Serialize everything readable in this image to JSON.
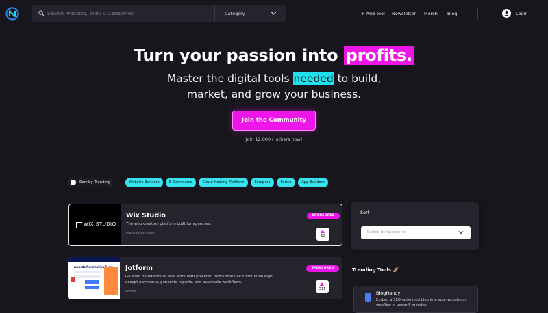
{
  "header": {
    "search_placeholder": "Search Products, Tools & Categories",
    "category_label": "Category",
    "nav": [
      "+ Add Tool",
      "Newsletter",
      "Merch",
      "Blog"
    ],
    "login_label": "Login"
  },
  "hero": {
    "title_part1": "Turn your passion into ",
    "title_highlight": "profits.",
    "subtitle_part1": "Master the digital tools ",
    "subtitle_highlight": "needed",
    "subtitle_part2": " to build,",
    "subtitle_line2": "market, and grow your business.",
    "cta_label": "Join the Community",
    "join_note": "Join 12,000+ others now!"
  },
  "filters": {
    "sort_label": "Sort by Trending",
    "chips": [
      "Website Builders",
      "E-Commerce",
      "Cloud Hosting Platform",
      "Scrapers",
      "Forms",
      "App Builders"
    ]
  },
  "tools": [
    {
      "name": "Wix Studio",
      "logo_text": "WIX STUDIO",
      "description": "The web creation platform built for agencies.",
      "category": "Website Builders",
      "badge": "SPONSORED",
      "votes": "62"
    },
    {
      "name": "Jotform",
      "thumb_caption": "Awards Nomination Form",
      "description": "Go from paperwork to less work with powerful forms that use conditional logic, accept payments, generate reports, and automate workflows.",
      "category": "Forms",
      "badge": "SPONSORED",
      "votes": "511"
    }
  ],
  "sidebar": {
    "sort_title": "Sort",
    "sort_value": "Sorted by Sponsored",
    "trending_title": "Trending Tools 🚀",
    "trending": [
      {
        "name": "BlogHandy",
        "description": "Embed a SEO optimized blog into your website or webflow in under 5 minutes"
      }
    ]
  },
  "colors": {
    "background": "#17161d",
    "accent_pink": "#ee15e9",
    "accent_cyan": "#20e0ee",
    "panel": "#25242c"
  }
}
